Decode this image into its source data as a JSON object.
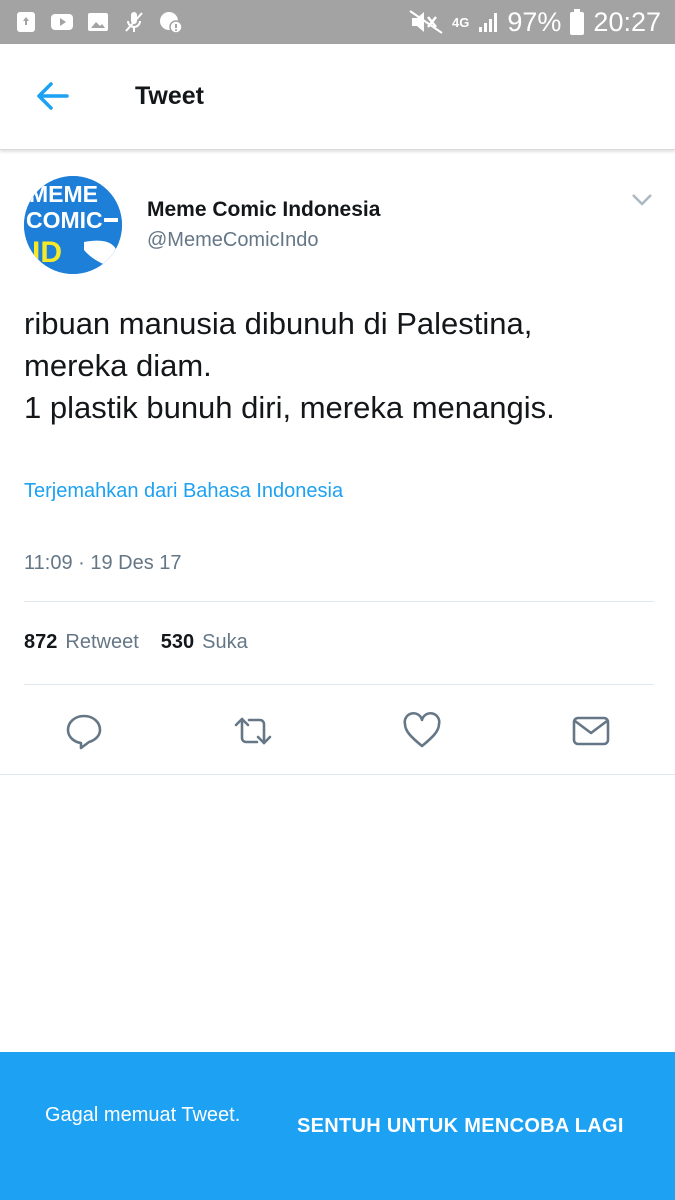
{
  "status_bar": {
    "battery_percent": "97%",
    "time": "20:27",
    "network": "4G",
    "icons": [
      "recycle-icon",
      "youtube-icon",
      "gallery-icon",
      "mic-off-icon",
      "vpn-icon",
      "mute-icon",
      "signal-icon",
      "battery-icon"
    ]
  },
  "header": {
    "title": "Tweet",
    "back_icon": "back-arrow-icon"
  },
  "tweet": {
    "avatar": {
      "lines": [
        "MEME",
        "COMIC",
        "ID"
      ],
      "colors": {
        "background": "#1e7fd8",
        "accent": "#f5e928"
      }
    },
    "author_name": "Meme Comic Indonesia",
    "author_handle": "@MemeComicIndo",
    "text_lines": [
      "ribuan manusia dibunuh di Palestina,",
      "mereka diam.",
      "1 plastik bunuh diri, mereka menangis."
    ],
    "translate_link": "Terjemahkan dari Bahasa Indonesia",
    "timestamp": "11:09 · 19 Des 17",
    "stats": {
      "retweet_count": "872",
      "retweet_label": "Retweet",
      "like_count": "530",
      "like_label": "Suka"
    },
    "actions": [
      "reply-icon",
      "retweet-icon",
      "like-icon",
      "message-icon"
    ]
  },
  "snackbar": {
    "message": "Gagal memuat Tweet.",
    "action": "SENTUH UNTUK MENCOBA LAGI"
  },
  "colors": {
    "accent": "#1da1f2",
    "status_bar": "#a3a3a3",
    "text_primary": "#14171a",
    "text_secondary": "#657786"
  }
}
